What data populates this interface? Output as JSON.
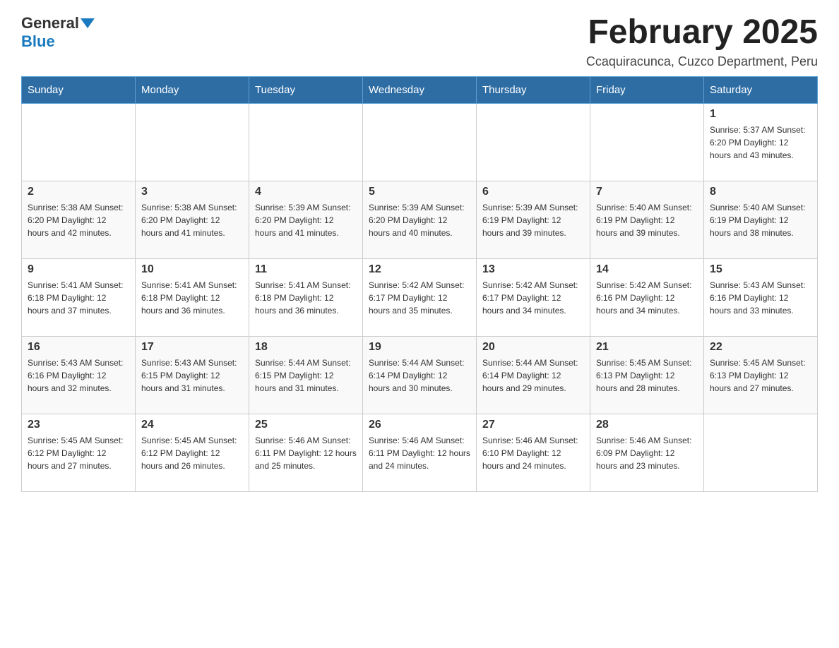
{
  "header": {
    "logo_general": "General",
    "logo_blue": "Blue",
    "month_title": "February 2025",
    "location": "Ccaquiracunca, Cuzco Department, Peru"
  },
  "weekdays": [
    "Sunday",
    "Monday",
    "Tuesday",
    "Wednesday",
    "Thursday",
    "Friday",
    "Saturday"
  ],
  "weeks": [
    [
      {
        "day": "",
        "info": ""
      },
      {
        "day": "",
        "info": ""
      },
      {
        "day": "",
        "info": ""
      },
      {
        "day": "",
        "info": ""
      },
      {
        "day": "",
        "info": ""
      },
      {
        "day": "",
        "info": ""
      },
      {
        "day": "1",
        "info": "Sunrise: 5:37 AM\nSunset: 6:20 PM\nDaylight: 12 hours and 43 minutes."
      }
    ],
    [
      {
        "day": "2",
        "info": "Sunrise: 5:38 AM\nSunset: 6:20 PM\nDaylight: 12 hours and 42 minutes."
      },
      {
        "day": "3",
        "info": "Sunrise: 5:38 AM\nSunset: 6:20 PM\nDaylight: 12 hours and 41 minutes."
      },
      {
        "day": "4",
        "info": "Sunrise: 5:39 AM\nSunset: 6:20 PM\nDaylight: 12 hours and 41 minutes."
      },
      {
        "day": "5",
        "info": "Sunrise: 5:39 AM\nSunset: 6:20 PM\nDaylight: 12 hours and 40 minutes."
      },
      {
        "day": "6",
        "info": "Sunrise: 5:39 AM\nSunset: 6:19 PM\nDaylight: 12 hours and 39 minutes."
      },
      {
        "day": "7",
        "info": "Sunrise: 5:40 AM\nSunset: 6:19 PM\nDaylight: 12 hours and 39 minutes."
      },
      {
        "day": "8",
        "info": "Sunrise: 5:40 AM\nSunset: 6:19 PM\nDaylight: 12 hours and 38 minutes."
      }
    ],
    [
      {
        "day": "9",
        "info": "Sunrise: 5:41 AM\nSunset: 6:18 PM\nDaylight: 12 hours and 37 minutes."
      },
      {
        "day": "10",
        "info": "Sunrise: 5:41 AM\nSunset: 6:18 PM\nDaylight: 12 hours and 36 minutes."
      },
      {
        "day": "11",
        "info": "Sunrise: 5:41 AM\nSunset: 6:18 PM\nDaylight: 12 hours and 36 minutes."
      },
      {
        "day": "12",
        "info": "Sunrise: 5:42 AM\nSunset: 6:17 PM\nDaylight: 12 hours and 35 minutes."
      },
      {
        "day": "13",
        "info": "Sunrise: 5:42 AM\nSunset: 6:17 PM\nDaylight: 12 hours and 34 minutes."
      },
      {
        "day": "14",
        "info": "Sunrise: 5:42 AM\nSunset: 6:16 PM\nDaylight: 12 hours and 34 minutes."
      },
      {
        "day": "15",
        "info": "Sunrise: 5:43 AM\nSunset: 6:16 PM\nDaylight: 12 hours and 33 minutes."
      }
    ],
    [
      {
        "day": "16",
        "info": "Sunrise: 5:43 AM\nSunset: 6:16 PM\nDaylight: 12 hours and 32 minutes."
      },
      {
        "day": "17",
        "info": "Sunrise: 5:43 AM\nSunset: 6:15 PM\nDaylight: 12 hours and 31 minutes."
      },
      {
        "day": "18",
        "info": "Sunrise: 5:44 AM\nSunset: 6:15 PM\nDaylight: 12 hours and 31 minutes."
      },
      {
        "day": "19",
        "info": "Sunrise: 5:44 AM\nSunset: 6:14 PM\nDaylight: 12 hours and 30 minutes."
      },
      {
        "day": "20",
        "info": "Sunrise: 5:44 AM\nSunset: 6:14 PM\nDaylight: 12 hours and 29 minutes."
      },
      {
        "day": "21",
        "info": "Sunrise: 5:45 AM\nSunset: 6:13 PM\nDaylight: 12 hours and 28 minutes."
      },
      {
        "day": "22",
        "info": "Sunrise: 5:45 AM\nSunset: 6:13 PM\nDaylight: 12 hours and 27 minutes."
      }
    ],
    [
      {
        "day": "23",
        "info": "Sunrise: 5:45 AM\nSunset: 6:12 PM\nDaylight: 12 hours and 27 minutes."
      },
      {
        "day": "24",
        "info": "Sunrise: 5:45 AM\nSunset: 6:12 PM\nDaylight: 12 hours and 26 minutes."
      },
      {
        "day": "25",
        "info": "Sunrise: 5:46 AM\nSunset: 6:11 PM\nDaylight: 12 hours and 25 minutes."
      },
      {
        "day": "26",
        "info": "Sunrise: 5:46 AM\nSunset: 6:11 PM\nDaylight: 12 hours and 24 minutes."
      },
      {
        "day": "27",
        "info": "Sunrise: 5:46 AM\nSunset: 6:10 PM\nDaylight: 12 hours and 24 minutes."
      },
      {
        "day": "28",
        "info": "Sunrise: 5:46 AM\nSunset: 6:09 PM\nDaylight: 12 hours and 23 minutes."
      },
      {
        "day": "",
        "info": ""
      }
    ]
  ]
}
